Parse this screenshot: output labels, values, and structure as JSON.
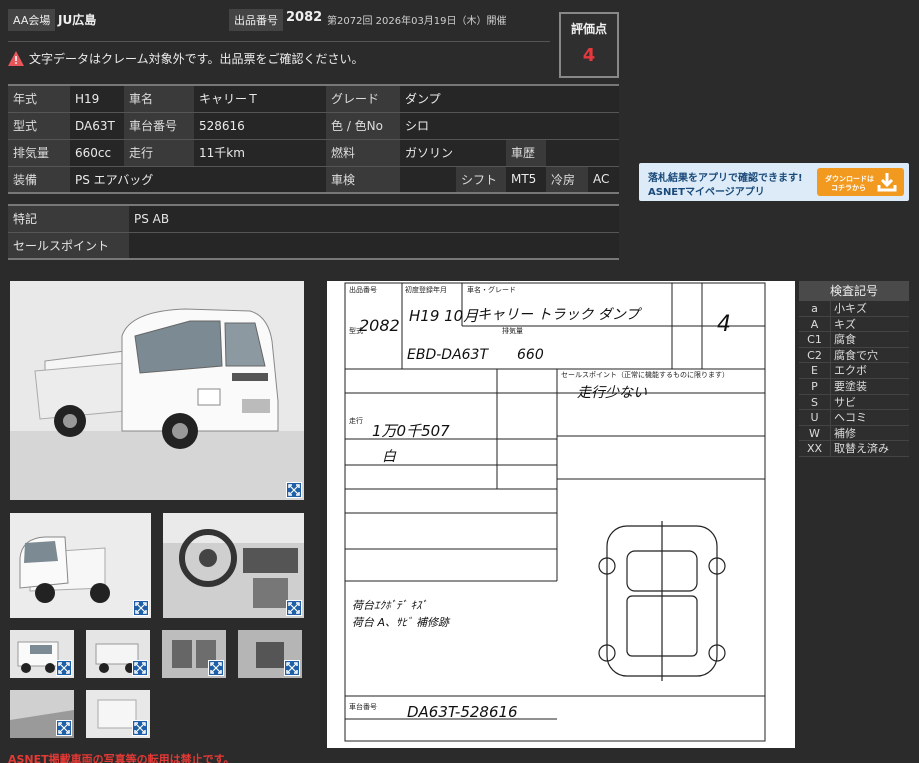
{
  "header": {
    "aa_label": "AA会場",
    "aa_value": "JU広島",
    "lot_label": "出品番号",
    "lot_value": "2082",
    "event": "第2072回 2026年03月19日（木）開催"
  },
  "warning": "文字データはクレーム対象外です。出品票をご確認ください。",
  "score": {
    "label": "評価点",
    "value": "4"
  },
  "spec": {
    "year_label": "年式",
    "year": "H19",
    "name_label": "車名",
    "name": "キャリーＴ",
    "grade_label": "グレード",
    "grade": "ダンプ",
    "model_label": "型式",
    "model": "DA63T",
    "chassis_label": "車台番号",
    "chassis": "528616",
    "color_label": "色 / 色No",
    "color": "シロ",
    "displacement_label": "排気量",
    "displacement": "660cc",
    "mileage_label": "走行",
    "mileage": "11千km",
    "fuel_label": "燃料",
    "fuel": "ガソリン",
    "history_label": "車歴",
    "history": "",
    "equipment_label": "装備",
    "equipment": "PS エアバッグ",
    "inspection_label": "車検",
    "inspection": "",
    "shift_label": "シフト",
    "shift": "MT5",
    "ac_label": "冷房",
    "ac": "AC"
  },
  "notes": {
    "special_label": "特記",
    "special": "PS AB",
    "sales_label": "セールスポイント",
    "sales": ""
  },
  "banner": {
    "line1": "落札結果をアプリで確認できます!",
    "line2": "ASNETマイページアプリ",
    "btn1": "ダウンロードは",
    "btn2": "コチラから"
  },
  "inspection_legend": {
    "title": "検査記号",
    "rows": [
      {
        "code": "a",
        "desc": "小キズ"
      },
      {
        "code": "A",
        "desc": "キズ"
      },
      {
        "code": "C1",
        "desc": "腐食"
      },
      {
        "code": "C2",
        "desc": "腐食で穴"
      },
      {
        "code": "E",
        "desc": "エクボ"
      },
      {
        "code": "P",
        "desc": "要塗装"
      },
      {
        "code": "S",
        "desc": "サビ"
      },
      {
        "code": "U",
        "desc": "ヘコミ"
      },
      {
        "code": "W",
        "desc": "補修"
      },
      {
        "code": "XX",
        "desc": "取替え済み"
      }
    ]
  },
  "sheet": {
    "lot_label": "出品番号",
    "lot": "2082",
    "year_label": "初度登録年月",
    "year_hand": "H19 10月",
    "name_label": "車名・グレード",
    "name_hand": "キャリー トラック ダンプ",
    "model_label": "型式",
    "model_hand": "EBD-DA63T",
    "cc_label": "排気量",
    "cc_hand": "660",
    "sales_label": "セールスポイント（正常に機能するものに限ります）",
    "sales_hand": "走行少ない",
    "mileage_label": "走行",
    "mileage_hand": "1万0千507",
    "color_hand": "白",
    "chassis_label": "車台番号",
    "chassis_hand": "DA63T-528616",
    "score_hand": "4",
    "notes_hand_1": "荷台ｴｸﾎﾞﾃﾞ ｷｽﾞ",
    "notes_hand_2": "荷台 A、ｻﾋﾞ 補修跡"
  },
  "footer": "ASNET掲載車両の写真等の転用は禁止です。"
}
